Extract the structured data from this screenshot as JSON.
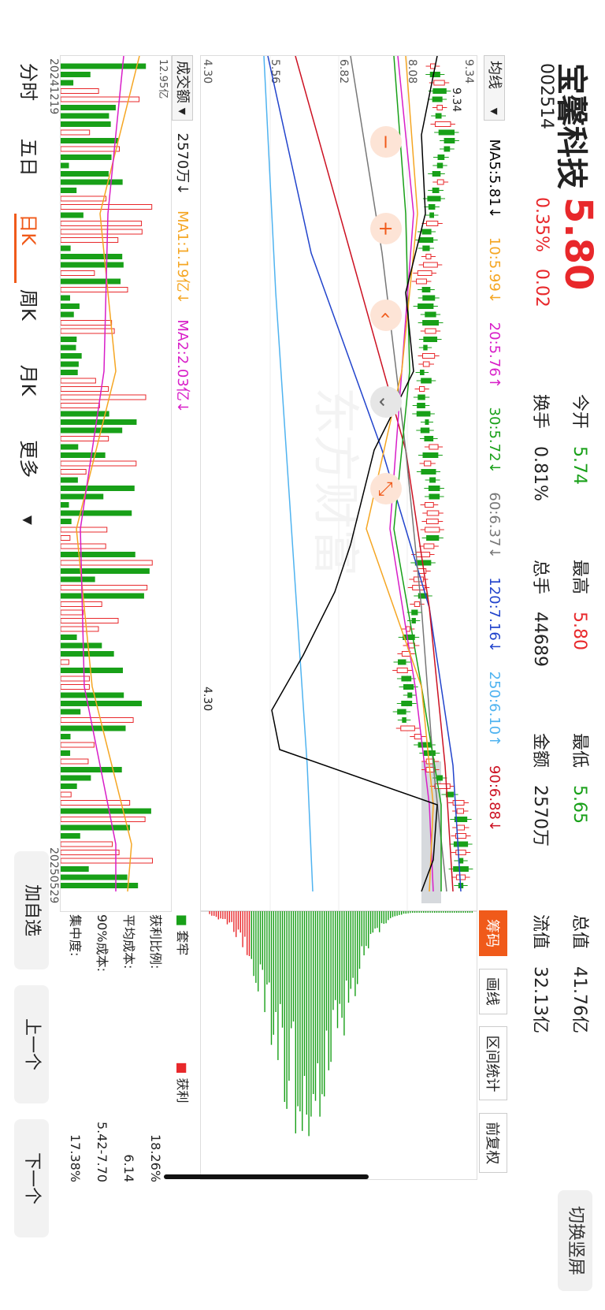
{
  "stock": {
    "name": "宝馨科技",
    "code": "002514",
    "price": "5.80",
    "change_pct": "0.35%",
    "change_amt": "0.02"
  },
  "stats": {
    "open_label": "今开",
    "open": "5.74",
    "high_label": "最高",
    "high": "5.80",
    "low_label": "最低",
    "low": "5.65",
    "total_label": "总值",
    "total": "41.76亿",
    "turnover_label": "换手",
    "turnover": "0.81%",
    "volume_label": "总手",
    "volume": "44689",
    "amount_label": "金额",
    "amount": "2570万",
    "float_label": "流值",
    "float": "32.13亿"
  },
  "switch_portrait": "切换竖屏",
  "ma_select": "均线",
  "ma_values": {
    "ma5": "MA5:5.81↓",
    "ma10": "10:5.99↓",
    "ma20": "20:5.76↑",
    "ma30": "30:5.72↓",
    "ma60": "60:6.37↓",
    "ma120": "120:7.16↓",
    "ma250": "250:6.10↑",
    "ma90": "90:6.88↓"
  },
  "side_tabs": [
    "筹码",
    "画线",
    "区间统计",
    "前复权"
  ],
  "price_axis": {
    "top": "9.34",
    "r1": "8.08",
    "r2": "6.82",
    "r3": "5.56",
    "bottom": "4.30"
  },
  "annotations": {
    "high": "9.34",
    "low": "4.30"
  },
  "watermark": "东方财富",
  "volume_header": {
    "select": "成交额",
    "value": "2570万↓",
    "ma1": "MA1:1.19亿↓",
    "ma2": "MA2:2.03亿↓",
    "axis_top": "12.95亿"
  },
  "dates": {
    "start": "20241219",
    "end": "20250529"
  },
  "chip": {
    "legend_loss": "套牢",
    "legend_profit": "获利",
    "profit_ratio_label": "获利比例:",
    "profit_ratio": "18.26%",
    "avg_cost_label": "平均成本:",
    "avg_cost": "6.14",
    "cost90_label": "90%成本:",
    "cost90": "5.42-7.70",
    "concentration_label": "集中度:",
    "concentration": "17.38%"
  },
  "period_tabs": [
    "分时",
    "五日",
    "日K",
    "周K",
    "月K",
    "更多"
  ],
  "active_period": "日K",
  "zoom_buttons": {
    "minus": "−",
    "plus": "+",
    "left": "‹",
    "down": "⌄",
    "shrink": "⤡"
  },
  "bottom_buttons": {
    "add": "加自选",
    "prev": "上一个",
    "next": "下一个"
  },
  "colors": {
    "up": "#e8282b",
    "down": "#18a018",
    "accent": "#f05a1a",
    "ma5": "#000000",
    "ma10": "#f5a623",
    "ma20": "#d81ec8",
    "ma30": "#18a018",
    "ma60": "#777777",
    "ma120": "#2244cc",
    "ma250": "#4fb3f0",
    "ma90": "#cc1122"
  }
}
